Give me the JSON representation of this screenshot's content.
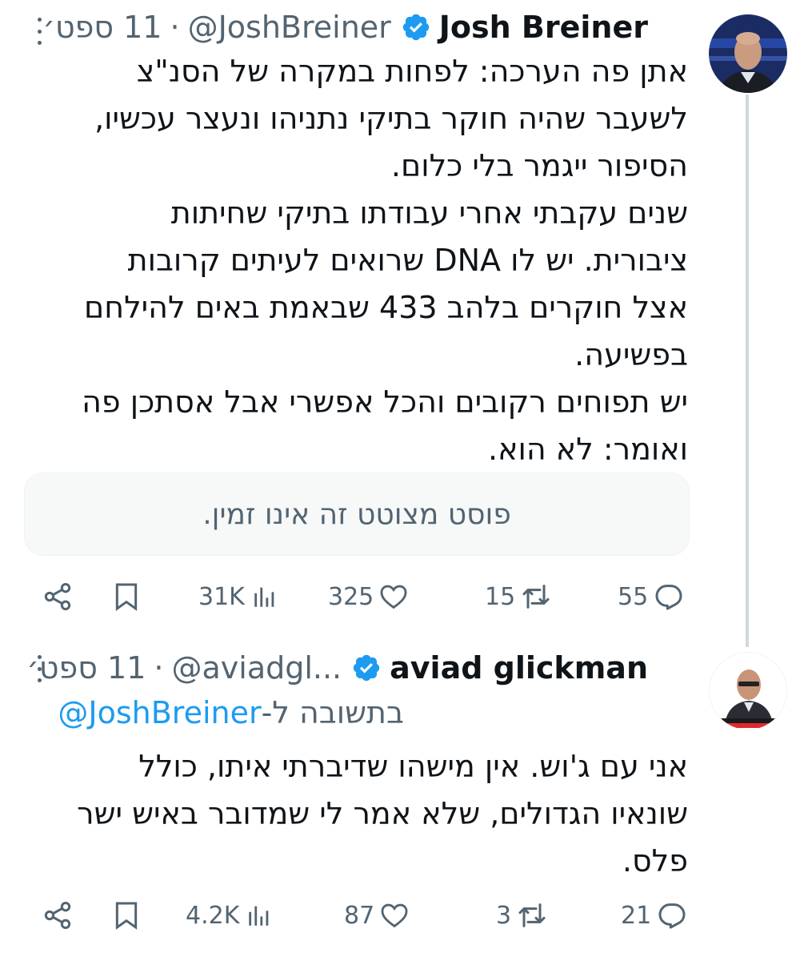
{
  "colors": {
    "accent": "#1d9bf0",
    "secondary": "#536471",
    "text": "#0f1419",
    "thread_line": "#cfd9de"
  },
  "tweet1": {
    "author": {
      "name": "Josh Breiner",
      "handle": "@JoshBreiner",
      "verified": true
    },
    "separator": "·",
    "date": "11 ספט׳",
    "body_lines": [
      "אתן פה הערכה: לפחות במקרה של הסנ\"צ",
      "לשעבר שהיה חוקר בתיקי נתניהו ונעצר עכשיו,",
      "הסיפור ייגמר בלי כלום.",
      "שנים עקבתי אחרי עבודתו בתיקי שחיתות",
      "ציבורית. יש לו DNA שרואים לעיתים קרובות",
      "אצל חוקרים בלהב 433 שבאמת באים להילחם",
      "בפשיעה.",
      "יש תפוחים רקובים והכל אפשרי אבל אסתכן פה",
      "ואומר: לא הוא."
    ],
    "quoted_post": "פוסט מצוטט זה אינו זמין.",
    "actions": {
      "replies": "55",
      "reposts": "15",
      "likes": "325",
      "views": "31K"
    },
    "icons": [
      "more-icon",
      "verified-badge-icon",
      "reply-icon",
      "repost-icon",
      "like-icon",
      "views-icon",
      "bookmark-icon",
      "share-icon"
    ]
  },
  "tweet2": {
    "author": {
      "name": "aviad glickman",
      "handle": "@aviadgl...",
      "verified": true
    },
    "separator": "·",
    "date": "11 ספט׳",
    "reply_prefix": "בתשובה ל-",
    "reply_mention": "@JoshBreiner",
    "body_lines": [
      "אני עם ג'וש. אין מישהו שדיברתי איתו, כולל",
      "שונאיו הגדולים, שלא אמר לי שמדובר באיש ישר",
      "פלס."
    ],
    "actions": {
      "replies": "21",
      "reposts": "3",
      "likes": "87",
      "views": "4.2K"
    }
  }
}
